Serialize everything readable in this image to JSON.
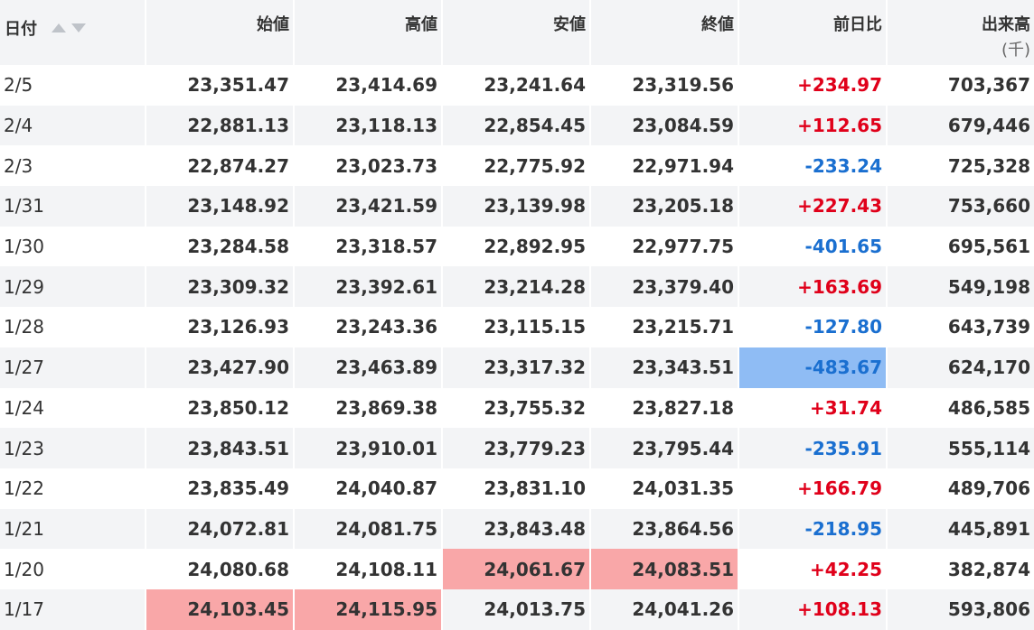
{
  "headers": {
    "date": "日付",
    "open": "始値",
    "high": "高値",
    "low": "安値",
    "close": "終値",
    "change": "前日比",
    "volume": "出来高",
    "volume_unit": "(千)"
  },
  "colors": {
    "up": "#e0001a",
    "down": "#1a6fd0",
    "highlight_red": "#f9a7a8",
    "highlight_blue": "#8fbcf4",
    "row_stripe": "#f3f4f6"
  },
  "rows": [
    {
      "date": "2/5",
      "open": "23,351.47",
      "high": "23,414.69",
      "low": "23,241.64",
      "close": "23,319.56",
      "change": "+234.97",
      "volume": "703,367",
      "direction": "up"
    },
    {
      "date": "2/4",
      "open": "22,881.13",
      "high": "23,118.13",
      "low": "22,854.45",
      "close": "23,084.59",
      "change": "+112.65",
      "volume": "679,446",
      "direction": "up"
    },
    {
      "date": "2/3",
      "open": "22,874.27",
      "high": "23,023.73",
      "low": "22,775.92",
      "close": "22,971.94",
      "change": "-233.24",
      "volume": "725,328",
      "direction": "down"
    },
    {
      "date": "1/31",
      "open": "23,148.92",
      "high": "23,421.59",
      "low": "23,139.98",
      "close": "23,205.18",
      "change": "+227.43",
      "volume": "753,660",
      "direction": "up"
    },
    {
      "date": "1/30",
      "open": "23,284.58",
      "high": "23,318.57",
      "low": "22,892.95",
      "close": "22,977.75",
      "change": "-401.65",
      "volume": "695,561",
      "direction": "down"
    },
    {
      "date": "1/29",
      "open": "23,309.32",
      "high": "23,392.61",
      "low": "23,214.28",
      "close": "23,379.40",
      "change": "+163.69",
      "volume": "549,198",
      "direction": "up"
    },
    {
      "date": "1/28",
      "open": "23,126.93",
      "high": "23,243.36",
      "low": "23,115.15",
      "close": "23,215.71",
      "change": "-127.80",
      "volume": "643,739",
      "direction": "down"
    },
    {
      "date": "1/27",
      "open": "23,427.90",
      "high": "23,463.89",
      "low": "23,317.32",
      "close": "23,343.51",
      "change": "-483.67",
      "volume": "624,170",
      "direction": "down"
    },
    {
      "date": "1/24",
      "open": "23,850.12",
      "high": "23,869.38",
      "low": "23,755.32",
      "close": "23,827.18",
      "change": "+31.74",
      "volume": "486,585",
      "direction": "up"
    },
    {
      "date": "1/23",
      "open": "23,843.51",
      "high": "23,910.01",
      "low": "23,779.23",
      "close": "23,795.44",
      "change": "-235.91",
      "volume": "555,114",
      "direction": "down"
    },
    {
      "date": "1/22",
      "open": "23,835.49",
      "high": "24,040.87",
      "low": "23,831.10",
      "close": "24,031.35",
      "change": "+166.79",
      "volume": "489,706",
      "direction": "up"
    },
    {
      "date": "1/21",
      "open": "24,072.81",
      "high": "24,081.75",
      "low": "23,843.48",
      "close": "23,864.56",
      "change": "-218.95",
      "volume": "445,891",
      "direction": "down"
    },
    {
      "date": "1/20",
      "open": "24,080.68",
      "high": "24,108.11",
      "low": "24,061.67",
      "close": "24,083.51",
      "change": "+42.25",
      "volume": "382,874",
      "direction": "up"
    },
    {
      "date": "1/17",
      "open": "24,103.45",
      "high": "24,115.95",
      "low": "24,013.75",
      "close": "24,041.26",
      "change": "+108.13",
      "volume": "593,806",
      "direction": "up"
    }
  ]
}
